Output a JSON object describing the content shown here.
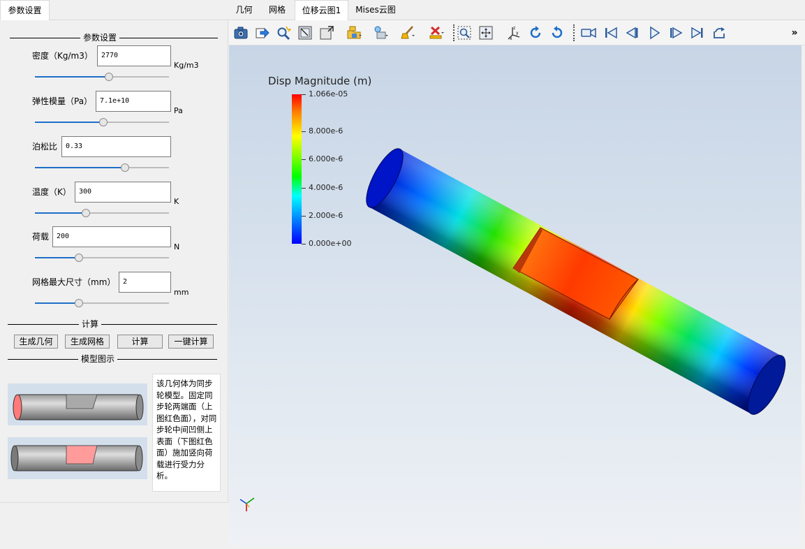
{
  "left": {
    "tab_label": "参数设置",
    "section_params": "参数设置",
    "params": [
      {
        "label": "密度（Kg/m3）",
        "value": "2770",
        "unit": "Kg/m3",
        "slider": 0.55
      },
      {
        "label": "弹性模量（Pa）",
        "value": "7.1e+10",
        "unit": "Pa",
        "slider": 0.51
      },
      {
        "label": "泊松比",
        "value": "0.33",
        "unit": "",
        "slider": 0.67
      },
      {
        "label": "温度（K）",
        "value": "300",
        "unit": "K",
        "slider": 0.38
      },
      {
        "label": "荷载",
        "value": "200",
        "unit": "N",
        "slider": 0.33
      },
      {
        "label": "网格最大尺寸（mm）",
        "value": "2",
        "unit": "mm",
        "slider": 0.33
      }
    ],
    "section_compute": "计算",
    "buttons": {
      "gen_geometry": "生成几何",
      "gen_mesh": "生成网格",
      "compute": "计算",
      "one_click": "一键计算"
    },
    "section_model": "模型图示",
    "description": "该几何体为同步轮模型。固定同步轮两端面（上图红色面），对同步轮中间凹侧上表面（下图红色面）施加竖向荷载进行受力分析。"
  },
  "right": {
    "tabs": [
      {
        "label": "几何",
        "active": false
      },
      {
        "label": "网格",
        "active": false
      },
      {
        "label": "位移云图1",
        "active": true
      },
      {
        "label": "Mises云图",
        "active": false
      }
    ],
    "toolbar_icons": [
      "camera-icon",
      "export-icon",
      "magnify-icon",
      "reset-view-icon",
      "zoom-box-icon",
      "folder-icon",
      "select-icon",
      "paint-brush-icon",
      "delete-icon",
      "zoom-select-icon",
      "pan-icon",
      "axes-icon",
      "rotate-cw-icon",
      "rotate-ccw-icon",
      "video-camera-icon",
      "first-frame-icon",
      "prev-frame-icon",
      "play-icon",
      "next-frame-icon",
      "last-frame-icon",
      "loop-icon"
    ],
    "overflow_label": "»",
    "legend": {
      "title": "Disp Magnitude (m)",
      "labels": [
        "1.066e-05",
        "8.000e-6",
        "6.000e-6",
        "4.000e-6",
        "2.000e-6",
        "0.000e+00"
      ],
      "colors": {
        "max": "#ff0000",
        "min": "#0000ff"
      }
    }
  }
}
